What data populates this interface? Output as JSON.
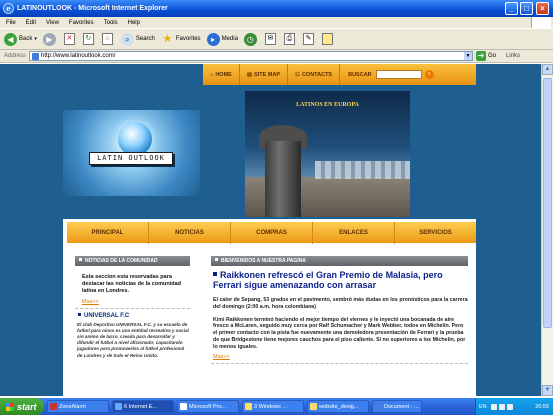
{
  "window": {
    "title": "LATINOUTLOOK - Microsoft Internet Explorer",
    "controls": [
      "_",
      "□",
      "×"
    ]
  },
  "menu": [
    "File",
    "Edit",
    "View",
    "Favorites",
    "Tools",
    "Help"
  ],
  "toolbar": {
    "back": "Back",
    "search": "Search",
    "favorites": "Favorites",
    "media": "Media"
  },
  "address": {
    "label": "Address",
    "url": "http://www.latinoutlook.com/",
    "go": "Go",
    "links": "Links"
  },
  "site": {
    "topnav": {
      "home": "HOME",
      "sitemap": "SITE MAP",
      "contacts": "CONTACTS",
      "buscar": "BUSCAR"
    },
    "logo_text": "LATIN OUTLOOK",
    "photo_caption": "LATINOS EN EUROPA",
    "mainnav": [
      "PRINCIPAL",
      "NOTICIAS",
      "COMPRAS",
      "ENLACES",
      "SERVICIOS"
    ],
    "left": {
      "header": "NOTICIAS DE LA COMUNIDAD",
      "intro": "Esta seccion esta reservadas para destacar las noticias de la comunidad  latina en Londres.",
      "more": "Mas>>",
      "item_title": "UNIVERSAL F.C",
      "item_text": "El club Deportivo UNIVERSAL F.C. y su escuela de futbol  para ninos es una entidad recreativa y social sin animo de lucro, creada para desarrollar y difundir el futbol a nivel aficionado; capacitando jugadores para promoverlos al futbol profesional de Londres y de todo el Reino Unido."
    },
    "right": {
      "header": "BIENVENIDOS A NUESTRA PAGINA",
      "headline": "Raikkonen refrescó el Gran Premio de Malasia, pero Ferrari sigue amenazando con arrasar",
      "para1": "El calor de Sepang, 53 grados en el pavimento, sembró más dudas en los pronósticos para la carrera del domingo (2:00 a.m. hora colombiana)",
      "para2": "Kimi Raikkonen terminó haciendo el mejor tiempo del viernes y le inyectó una bocanada de aire fresco a McLaren, seguido muy cerca por Ralf Schumacher y Mark Webber, todos en Michelin. Pero el primer contacto con la pista fue nuevamente una demoledora presentación de Ferrari y la prueba de que Bridgestone tiene mejores cauchos para el piso caliente. Si no superiores a los Michelin, por lo menos iguales.",
      "more": "Mas>>"
    }
  },
  "taskbar": {
    "start": "start",
    "tasks": [
      "ZoneAlarm",
      "6 Internet E...",
      "Microsoft Pro...",
      "3 Windows ...",
      "website_desig...",
      "Document - ..."
    ],
    "lang": "EN",
    "clock": "20:55"
  }
}
